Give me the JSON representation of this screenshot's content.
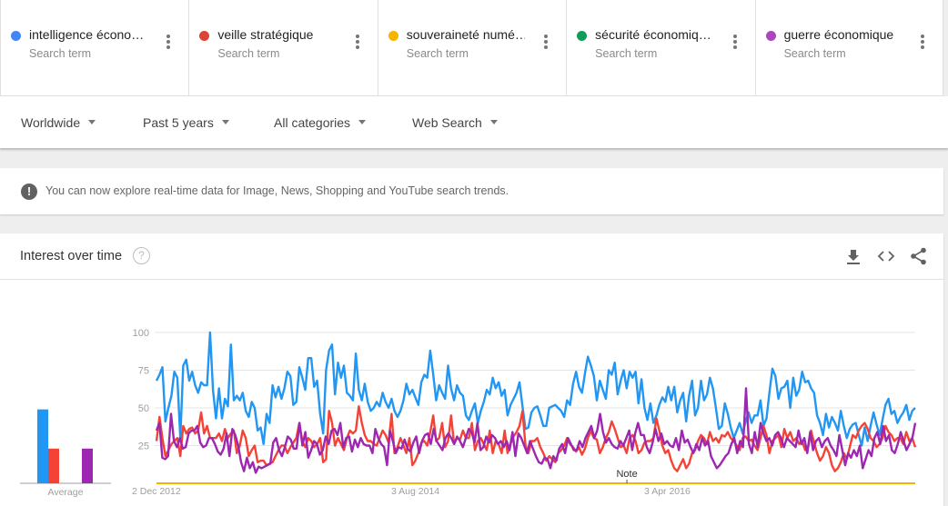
{
  "terms": [
    {
      "name": "intelligence écono…",
      "subtitle": "Search term",
      "color": "#4285f4"
    },
    {
      "name": "veille stratégique",
      "subtitle": "Search term",
      "color": "#db4437"
    },
    {
      "name": "souveraineté numé…",
      "subtitle": "Search term",
      "color": "#f4b400"
    },
    {
      "name": "sécurité économiq…",
      "subtitle": "Search term",
      "color": "#0f9d58"
    },
    {
      "name": "guerre économique",
      "subtitle": "Search term",
      "color": "#ab47bc"
    }
  ],
  "filters": {
    "region": "Worldwide",
    "time": "Past 5 years",
    "category": "All categories",
    "property": "Web Search"
  },
  "banner": {
    "icon": "exclamation-icon",
    "message": "You can now explore real-time data for Image, News, Shopping and YouTube search trends."
  },
  "card": {
    "title": "Interest over time",
    "help_icon": "?",
    "tools": [
      "download-icon",
      "embed-icon",
      "share-icon"
    ]
  },
  "chart_data": {
    "type": "line",
    "title": "Interest over time",
    "xlabel": "",
    "ylabel": "",
    "ylim": [
      0,
      100
    ],
    "y_ticks": [
      "100",
      "75",
      "50",
      "25"
    ],
    "x_tick_labels": [
      "2 Dec 2012",
      "3 Aug 2014",
      "3 Apr 2016"
    ],
    "x_tick_positions": [
      0,
      0.3333,
      0.6667
    ],
    "grid": true,
    "annotation": "Note",
    "annotation_position": 0.62,
    "average": {
      "label": "Average",
      "values": [
        {
          "name": "intelligence économique",
          "value": 49,
          "color": "#2196f3"
        },
        {
          "name": "veille stratégique",
          "value": 23,
          "color": "#f44336"
        },
        {
          "name": "souveraineté numérique",
          "value": 0,
          "color": "#f4b400"
        },
        {
          "name": "sécurité économique",
          "value": 0,
          "color": "#0f9d58"
        },
        {
          "name": "guerre économique",
          "value": 23,
          "color": "#9c27b0"
        }
      ]
    },
    "series": [
      {
        "name": "intelligence économique",
        "color": "#2196f3",
        "values": [
          68,
          72,
          77,
          41,
          50,
          58,
          74,
          70,
          30,
          78,
          82,
          68,
          74,
          65,
          60,
          67,
          65,
          65,
          100,
          62,
          43,
          63,
          43,
          56,
          51,
          92,
          55,
          58,
          55,
          60,
          48,
          44,
          54,
          50,
          35,
          37,
          26,
          46,
          40,
          65,
          57,
          64,
          56,
          63,
          74,
          71,
          52,
          54,
          77,
          70,
          62,
          83,
          83,
          64,
          68,
          46,
          33,
          75,
          88,
          92,
          59,
          80,
          70,
          78,
          60,
          58,
          55,
          86,
          62,
          55,
          66,
          54,
          48,
          50,
          54,
          51,
          60,
          54,
          50,
          56,
          48,
          44,
          48,
          55,
          66,
          59,
          62,
          57,
          52,
          67,
          72,
          70,
          88,
          72,
          55,
          65,
          60,
          56,
          78,
          63,
          55,
          65,
          60,
          58,
          45,
          42,
          48,
          53,
          40,
          48,
          54,
          62,
          59,
          70,
          63,
          67,
          58,
          62,
          45,
          52,
          56,
          60,
          67,
          51,
          36,
          37,
          47,
          50,
          51,
          45,
          38,
          38,
          50,
          51,
          52,
          50,
          48,
          44,
          55,
          52,
          66,
          74,
          64,
          60,
          73,
          84,
          78,
          71,
          55,
          68,
          62,
          56,
          75,
          72,
          80,
          59,
          68,
          75,
          63,
          74,
          70,
          74,
          53,
          69,
          50,
          42,
          53,
          40,
          45,
          52,
          57,
          54,
          64,
          55,
          64,
          47,
          55,
          60,
          41,
          58,
          68,
          45,
          50,
          68,
          55,
          59,
          70,
          63,
          50,
          36,
          38,
          53,
          46,
          37,
          30,
          35,
          40,
          33,
          41,
          47,
          40,
          45,
          45,
          55,
          38,
          43,
          60,
          76,
          71,
          56,
          63,
          64,
          68,
          50,
          70,
          58,
          62,
          74,
          67,
          68,
          63,
          60,
          45,
          40,
          32,
          46,
          37,
          44,
          40,
          35,
          48,
          38,
          30,
          36,
          39,
          40,
          32,
          25,
          37,
          28,
          38,
          47,
          39,
          32,
          42,
          52,
          56,
          46,
          48,
          40,
          44,
          47,
          52,
          42,
          48,
          50
        ]
      },
      {
        "name": "veille stratégique",
        "color": "#f44336",
        "values": [
          28,
          44,
          30,
          18,
          22,
          26,
          28,
          30,
          18,
          38,
          33,
          36,
          37,
          33,
          35,
          47,
          33,
          38,
          30,
          30,
          30,
          33,
          28,
          36,
          30,
          33,
          35,
          20,
          25,
          35,
          30,
          18,
          22,
          25,
          14,
          15,
          15,
          12,
          13,
          14,
          18,
          22,
          25,
          25,
          20,
          24,
          27,
          30,
          40,
          28,
          24,
          30,
          28,
          24,
          26,
          30,
          14,
          16,
          48,
          40,
          25,
          30,
          26,
          22,
          30,
          35,
          33,
          35,
          51,
          40,
          32,
          28,
          28,
          26,
          25,
          30,
          35,
          32,
          27,
          46,
          20,
          24,
          30,
          25,
          20,
          30,
          12,
          15,
          20,
          27,
          28,
          25,
          34,
          45,
          28,
          30,
          40,
          24,
          28,
          45,
          26,
          30,
          29,
          35,
          30,
          30,
          40,
          22,
          28,
          30,
          26,
          22,
          35,
          20,
          28,
          26,
          20,
          35,
          20,
          26,
          31,
          34,
          38,
          48,
          25,
          20,
          28,
          28,
          30,
          24,
          20,
          15,
          18,
          16,
          14,
          20,
          22,
          25,
          30,
          26,
          24,
          21,
          24,
          19,
          23,
          30,
          35,
          30,
          29,
          20,
          24,
          30,
          34,
          41,
          36,
          30,
          24,
          25,
          20,
          30,
          32,
          28,
          20,
          22,
          27,
          28,
          28,
          30,
          43,
          35,
          25,
          20,
          22,
          15,
          10,
          8,
          12,
          16,
          10,
          13,
          20,
          22,
          28,
          32,
          30,
          26,
          34,
          28,
          30,
          27,
          32,
          31,
          34,
          30,
          28,
          25,
          22,
          30,
          31,
          28,
          29,
          25,
          22,
          30,
          38,
          32,
          20,
          28,
          30,
          32,
          24,
          36,
          30,
          34,
          28,
          30,
          26,
          28,
          22,
          24,
          35,
          27,
          20,
          15,
          18,
          24,
          20,
          12,
          8,
          10,
          14,
          20,
          16,
          24,
          32,
          30,
          35,
          38,
          40,
          36,
          30,
          28,
          24,
          26,
          30,
          38,
          34,
          32,
          28,
          30,
          30,
          26,
          34,
          28,
          30,
          24
        ]
      },
      {
        "name": "souveraineté numérique",
        "color": "#f4b400",
        "values": [
          0,
          0,
          0,
          0,
          0,
          0,
          0,
          0,
          0,
          0,
          0,
          0,
          0,
          0,
          0,
          0,
          0,
          0,
          0,
          0,
          0,
          0,
          0,
          0,
          0,
          0,
          0,
          0,
          0,
          0,
          0,
          0,
          0,
          0,
          0,
          0,
          0,
          0,
          0,
          0
        ]
      },
      {
        "name": "sécurité économique",
        "color": "#0f9d58",
        "values": [
          0,
          0,
          0,
          0,
          0,
          0,
          0,
          0,
          0,
          0,
          0,
          0,
          0,
          0,
          0,
          0,
          0,
          0,
          0,
          0,
          0,
          0,
          0,
          0,
          0,
          0,
          0,
          0,
          0,
          0,
          0,
          0,
          0,
          0,
          0,
          0,
          0,
          0,
          0,
          0
        ]
      },
      {
        "name": "guerre économique",
        "color": "#9c27b0",
        "values": [
          35,
          40,
          17,
          16,
          18,
          46,
          28,
          24,
          30,
          23,
          24,
          33,
          35,
          35,
          38,
          27,
          24,
          25,
          30,
          30,
          26,
          21,
          19,
          23,
          33,
          18,
          36,
          32,
          25,
          14,
          8,
          17,
          10,
          14,
          7,
          11,
          10,
          11,
          12,
          13,
          27,
          30,
          22,
          18,
          24,
          31,
          29,
          23,
          23,
          40,
          25,
          34,
          17,
          22,
          28,
          26,
          19,
          22,
          31,
          26,
          35,
          36,
          32,
          40,
          24,
          30,
          31,
          21,
          29,
          24,
          30,
          26,
          25,
          25,
          20,
          36,
          30,
          26,
          24,
          12,
          35,
          28,
          20,
          24,
          23,
          29,
          23,
          21,
          27,
          31,
          20,
          28,
          32,
          33,
          26,
          36,
          28,
          25,
          22,
          30,
          33,
          30,
          26,
          31,
          28,
          24,
          30,
          36,
          34,
          27,
          40,
          22,
          24,
          31,
          27,
          32,
          30,
          26,
          28,
          24,
          28,
          22,
          34,
          18,
          33,
          30,
          25,
          20,
          28,
          23,
          18,
          14,
          13,
          17,
          16,
          10,
          18,
          15,
          23,
          26,
          20,
          30,
          26,
          22,
          22,
          28,
          24,
          30,
          34,
          38,
          30,
          35,
          46,
          34,
          27,
          30,
          26,
          24,
          23,
          28,
          25,
          30,
          35,
          22,
          33,
          40,
          32,
          32,
          24,
          20,
          27,
          36,
          28,
          33,
          26,
          28,
          25,
          24,
          30,
          22,
          35,
          27,
          29,
          24,
          20,
          26,
          22,
          30,
          25,
          28,
          18,
          14,
          10,
          12,
          15,
          18,
          20,
          26,
          30,
          20,
          28,
          24,
          63,
          26,
          20,
          34,
          24,
          40,
          33,
          28,
          30,
          25,
          32,
          34,
          30,
          24,
          30,
          28,
          26,
          24,
          35,
          26,
          30,
          20,
          34,
          22,
          28,
          30,
          24,
          28,
          30,
          25,
          22,
          18,
          32,
          22,
          12,
          20,
          17,
          22,
          18,
          25,
          10,
          16,
          22,
          18,
          30,
          34,
          26,
          38,
          28,
          32,
          22,
          20,
          26,
          34,
          28,
          22,
          26,
          30,
          40
        ]
      }
    ]
  }
}
